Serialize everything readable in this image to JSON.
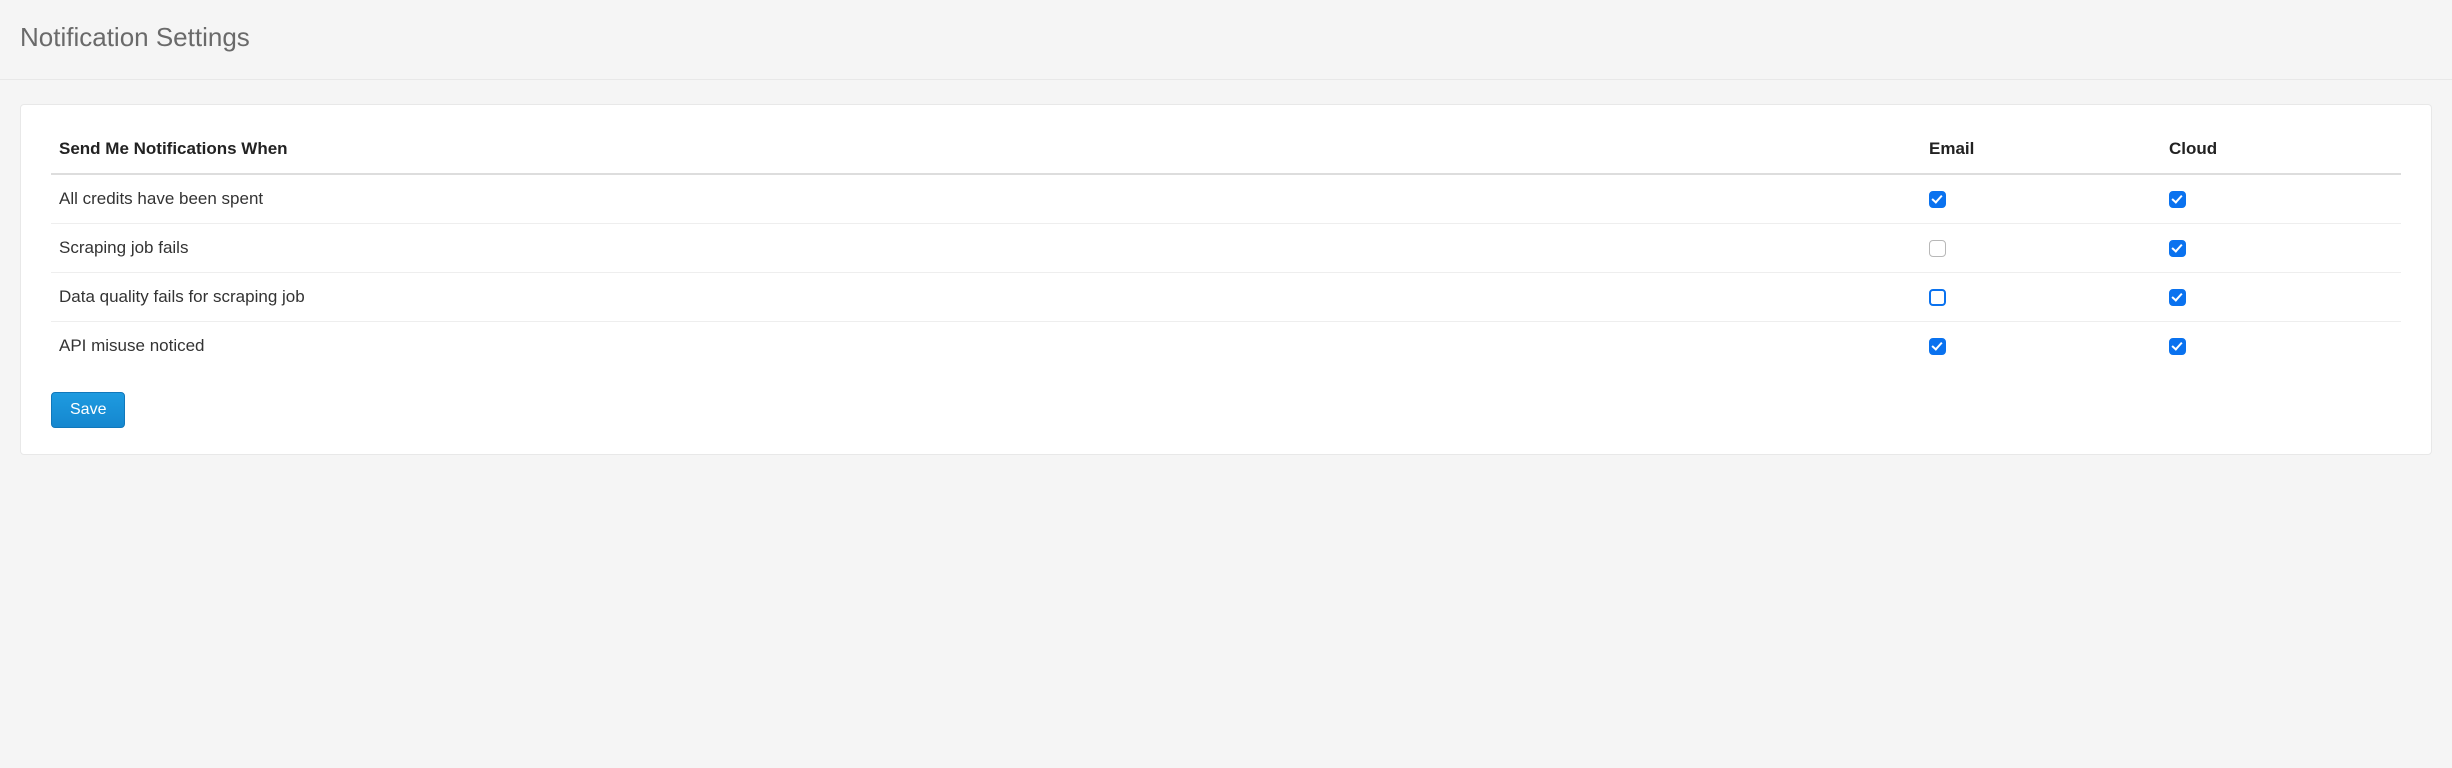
{
  "page": {
    "title": "Notification Settings"
  },
  "table": {
    "header_label": "Send Me Notifications When",
    "col_email": "Email",
    "col_cloud": "Cloud",
    "rows": [
      {
        "label": "All credits have been spent",
        "email": true,
        "cloud": true,
        "email_focus": false
      },
      {
        "label": "Scraping job fails",
        "email": false,
        "cloud": true,
        "email_focus": false
      },
      {
        "label": "Data quality fails for scraping job",
        "email": false,
        "cloud": true,
        "email_focus": true
      },
      {
        "label": "API misuse noticed",
        "email": true,
        "cloud": true,
        "email_focus": false
      }
    ]
  },
  "buttons": {
    "save": "Save"
  }
}
